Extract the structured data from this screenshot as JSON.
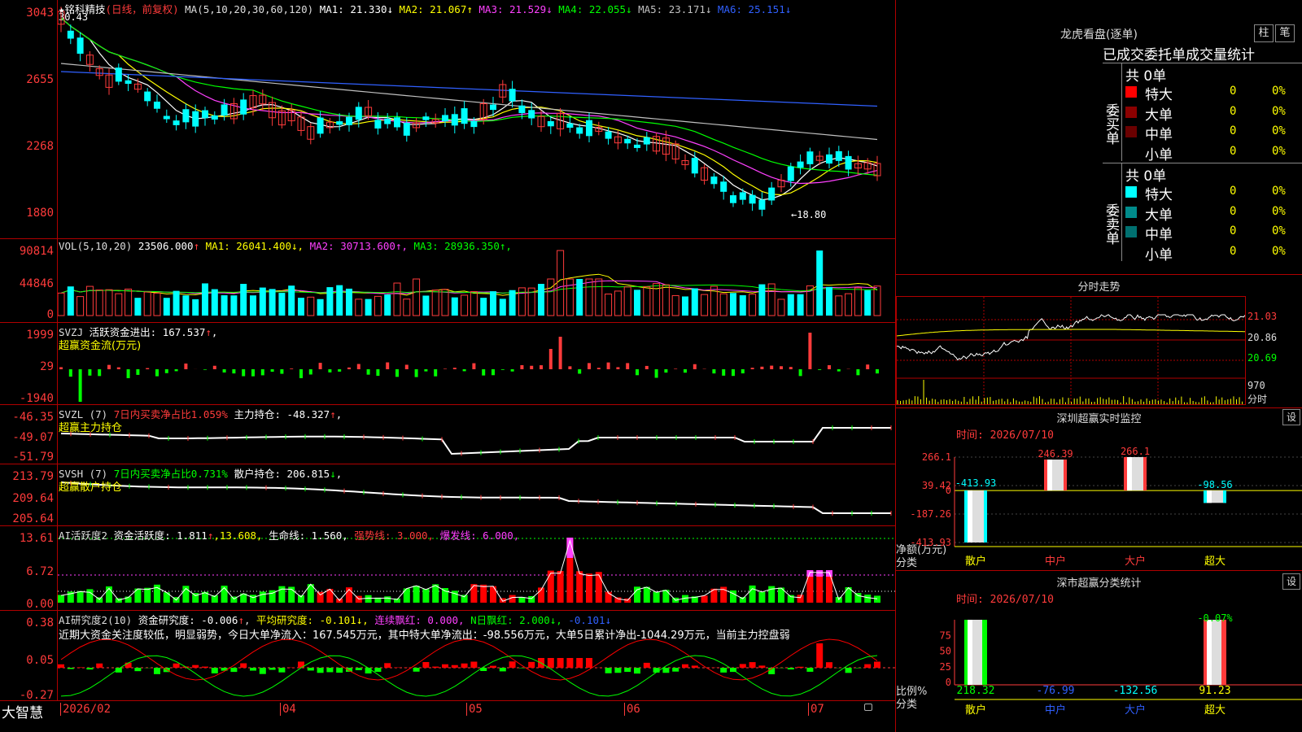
{
  "stock": {
    "star": "★",
    "name": "铭科精技",
    "period": "(日线，前复权)"
  },
  "main": {
    "ma_prefix": "MA(5,10,20,30,60,120)",
    "ma_items": [
      {
        "label": "MA1:",
        "value": "21.330",
        "arrow": "↓",
        "color": "#ffffff"
      },
      {
        "label": "MA2:",
        "value": "21.067",
        "arrow": "↑",
        "color": "#ffff00"
      },
      {
        "label": "MA3:",
        "value": "21.529",
        "arrow": "↓",
        "color": "#ff40ff"
      },
      {
        "label": "MA4:",
        "value": "22.055",
        "arrow": "↓",
        "color": "#00ff00"
      },
      {
        "label": "MA5:",
        "value": "23.171",
        "arrow": "↓",
        "color": "#c0c0c0"
      },
      {
        "label": "MA6:",
        "value": "25.151",
        "arrow": "↓",
        "color": "#3060ff"
      }
    ],
    "yticks": [
      "3043",
      "2655",
      "2268",
      "1880"
    ],
    "high_label": "30.43",
    "low_label": "←18.80"
  },
  "vol": {
    "prefix": "VOL(5,10,20)",
    "value": "23506.000",
    "arrow": "↑",
    "ma": [
      {
        "label": "MA1:",
        "value": "26041.400",
        "arrow": "↓",
        "color": "#ffff00"
      },
      {
        "label": "MA2:",
        "value": "30713.600",
        "arrow": "↑",
        "color": "#ff40ff"
      },
      {
        "label": "MA3:",
        "value": "28936.350",
        "arrow": "↑",
        "color": "#00ff00"
      }
    ],
    "yticks": [
      "90814",
      "44846",
      "0"
    ]
  },
  "svzj": {
    "label": "SVZJ",
    "desc": "活跃资金进出:",
    "value": "167.537",
    "arrow": "↑",
    "tail": ",",
    "sub": "超赢资金流(万元)",
    "yticks": [
      "1999",
      "29",
      "-1940"
    ]
  },
  "svzl": {
    "label": "SVZL (7)",
    "ratio": "7日内买卖净占比1.059%",
    "desc": "主力持仓:",
    "value": "-48.327",
    "arrow": "↑",
    "tail": ",",
    "sub": "超赢主力持仓",
    "yticks": [
      "-46.35",
      "-49.07",
      "-51.79"
    ]
  },
  "svsh": {
    "label": "SVSH (7)",
    "ratio": "7日内买卖净占比0.731%",
    "desc": "散户持仓:",
    "value": "206.815",
    "arrow": "↓",
    "tail": ",",
    "sub": "超赢散户持仓",
    "yticks": [
      "213.79",
      "209.64",
      "205.64"
    ]
  },
  "ai_act": {
    "label": "AI活跃度2",
    "desc": "资金活跃度:",
    "value": "1.811",
    "arrow": "↑",
    "v2": ",13.608,",
    "life": "生命线:",
    "life_v": "1.560,",
    "strong": "强势线: 3.000,",
    "burst": "爆发线: 6.000,",
    "yticks": [
      "13.61",
      "6.72",
      "0.00"
    ]
  },
  "ai_res": {
    "label": "AI研究度2(10)",
    "desc": "资金研究度:",
    "value": "-0.006",
    "arrow": "↑",
    "avg": "平均研究度: -0.101↓,",
    "lianxu": "连续飘红: 0.000,",
    "nri": "N日飘红: 2.000↓,",
    "last": "-0.101↓",
    "summary": "近期大资金关注度较低，明显弱势，今日大单净流入：167.545万元，其中特大单净流出：-98.556万元，大单5日累计净出-1044.29万元，当前主力控盘弱",
    "yticks": [
      "0.38",
      "0.05",
      "-0.27"
    ]
  },
  "date_axis": {
    "brand": "大智慧",
    "labels": [
      "2026/02",
      "04",
      "05",
      "06",
      "07"
    ]
  },
  "longhu": {
    "title": "龙虎看盘(逐单)",
    "btn1": "柱",
    "btn2": "笔",
    "subtitle": "已成交委托单成交量统计",
    "buy": {
      "side": "委买单",
      "total": "共 0单",
      "rows": [
        {
          "label": "特大",
          "count": "0",
          "pct": "0%",
          "color": "#ff0000"
        },
        {
          "label": "大单",
          "count": "0",
          "pct": "0%",
          "color": "#8b0000"
        },
        {
          "label": "中单",
          "count": "0",
          "pct": "0%",
          "color": "#6a0000"
        },
        {
          "label": "小单",
          "count": "0",
          "pct": "0%",
          "color": ""
        }
      ]
    },
    "sell": {
      "side": "委卖单",
      "total": "共 0单",
      "rows": [
        {
          "label": "特大",
          "count": "0",
          "pct": "0%",
          "color": "#00ffff"
        },
        {
          "label": "大单",
          "count": "0",
          "pct": "0%",
          "color": "#008b8b"
        },
        {
          "label": "中单",
          "count": "0",
          "pct": "0%",
          "color": "#007070"
        },
        {
          "label": "小单",
          "count": "0",
          "pct": "0%",
          "color": ""
        }
      ]
    }
  },
  "intraday": {
    "title": "分时走势",
    "prices": [
      "21.03",
      "20.86",
      "20.69"
    ],
    "vol": "970",
    "unit": "分时"
  },
  "sz_monitor": {
    "title": "深圳超赢实时监控",
    "set": "设",
    "time": "时间: 2026/07/10",
    "yticks": [
      "266.1",
      "39.42",
      "0",
      "-187.26",
      "-413.93"
    ],
    "ylabel1": "净额(万元)",
    "ylabel2": "分类",
    "bars": [
      {
        "cat": "散户",
        "value": -413.93,
        "label": "-413.93"
      },
      {
        "cat": "中户",
        "value": 246.39,
        "label": "246.39"
      },
      {
        "cat": "大户",
        "value": 266.1,
        "label": "266.1"
      },
      {
        "cat": "超大",
        "value": -98.56,
        "label": "-98.56"
      }
    ]
  },
  "sz_class": {
    "title": "深市超赢分类统计",
    "set": "设",
    "time": "时间: 2026/07/10",
    "yticks": [
      "75",
      "50",
      "25",
      "0"
    ],
    "ylabel1": "比例%",
    "ylabel2": "分类",
    "top_label": "-0.07%",
    "bars": [
      {
        "cat": "散户",
        "pct": 100,
        "label": "218.32"
      },
      {
        "cat": "中户",
        "pct": 0,
        "label": "-76.99"
      },
      {
        "cat": "大户",
        "pct": 0,
        "label": "-132.56"
      },
      {
        "cat": "超大",
        "pct": 100,
        "label": "91.23"
      }
    ]
  },
  "colors": {
    "up": "#ff3b3b",
    "down": "#00ffff",
    "grid": "#b00000",
    "green": "#00ff00",
    "yellow": "#ffff00",
    "magenta": "#ff40ff"
  }
}
